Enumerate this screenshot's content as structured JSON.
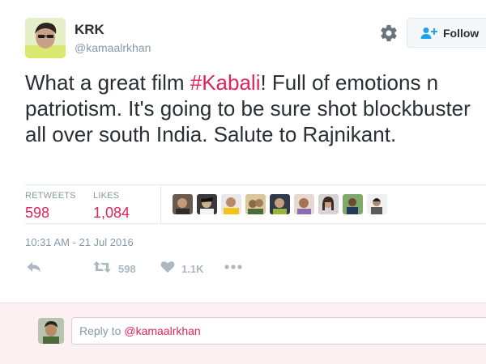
{
  "author": {
    "name": "KRK",
    "handle": "@kamaalrkhan"
  },
  "follow_button": {
    "label": "Follow",
    "icon": "follow-person-plus-icon"
  },
  "settings": {
    "icon": "gear-icon"
  },
  "tweet": {
    "before_hashtag": "What a great film ",
    "hashtag": "#Kabali",
    "after_hashtag": "! Full of emotions n patriotism. It's going to be sure shot blockbuster all over south India. Salute to Rajnikant."
  },
  "stats": {
    "retweets_label": "RETWEETS",
    "retweets_value": "598",
    "likes_label": "LIKES",
    "likes_value": "1,084"
  },
  "liker_count": 9,
  "timestamp": "10:31 AM - 21 Jul 2016",
  "actions": {
    "reply_icon": "reply-icon",
    "retweet_icon": "retweet-icon",
    "retweet_count": "598",
    "like_icon": "heart-icon",
    "like_count": "1.1K",
    "more_icon": "more-dots-icon"
  },
  "reply": {
    "prefix": "Reply to",
    "mention": "@kamaalrkhan"
  },
  "colors": {
    "accent": "#e0245e",
    "muted": "#8899a6",
    "text": "#292f33",
    "reply_bg": "#fcf0f3"
  }
}
